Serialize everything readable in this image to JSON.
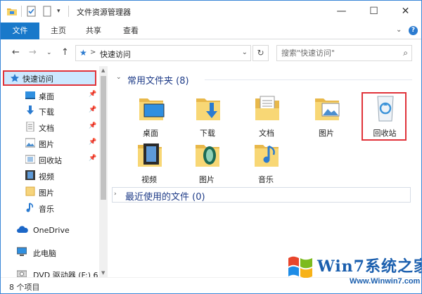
{
  "window": {
    "title": "文件资源管理器",
    "accent": "#1979ca",
    "controls": {
      "minimize": "—",
      "maximize": "☐",
      "close": "✕"
    }
  },
  "ribbon": {
    "tabs": [
      {
        "label": "文件"
      },
      {
        "label": "主页"
      },
      {
        "label": "共享"
      },
      {
        "label": "查看"
      }
    ],
    "expand_icon": "chevron-down-icon",
    "help_icon": "help-icon"
  },
  "address_bar": {
    "path_label": "快速访问",
    "separator": ">",
    "search_placeholder": "搜索\"快速访问\""
  },
  "sidebar": {
    "items": [
      {
        "label": "快速访问",
        "icon": "star-icon",
        "selected": true
      },
      {
        "label": "桌面",
        "icon": "desktop-icon",
        "pinned": true
      },
      {
        "label": "下载",
        "icon": "download-icon",
        "pinned": true
      },
      {
        "label": "文档",
        "icon": "document-icon",
        "pinned": true
      },
      {
        "label": "图片",
        "icon": "pictures-icon",
        "pinned": true
      },
      {
        "label": "回收站",
        "icon": "recycle-bin-icon",
        "pinned": true
      },
      {
        "label": "视频",
        "icon": "video-icon"
      },
      {
        "label": "图片",
        "icon": "folder-icon"
      },
      {
        "label": "音乐",
        "icon": "music-icon"
      },
      {
        "label": "OneDrive",
        "icon": "onedrive-icon"
      },
      {
        "label": "此电脑",
        "icon": "computer-icon"
      },
      {
        "label": "DVD 驱动器 (F:) 6",
        "icon": "dvd-icon"
      }
    ]
  },
  "content": {
    "frequent_group": {
      "label": "常用文件夹 (8)"
    },
    "frequent_items": [
      {
        "label": "桌面",
        "icon": "desktop-folder-icon"
      },
      {
        "label": "下载",
        "icon": "download-folder-icon"
      },
      {
        "label": "文档",
        "icon": "document-folder-icon"
      },
      {
        "label": "图片",
        "icon": "pictures-folder-icon"
      },
      {
        "label": "回收站",
        "icon": "recycle-bin-icon"
      },
      {
        "label": "视频",
        "icon": "video-folder-icon"
      },
      {
        "label": "图片",
        "icon": "pictures-folder-icon"
      },
      {
        "label": "音乐",
        "icon": "music-folder-icon"
      }
    ],
    "recent_group": {
      "label": "最近使用的文件 (0)"
    }
  },
  "status_bar": {
    "text": "8 个项目"
  },
  "watermark": {
    "main": "Win7系统之家",
    "url": "Www.Winwin7.com"
  },
  "highlight_color": "#e0333a"
}
